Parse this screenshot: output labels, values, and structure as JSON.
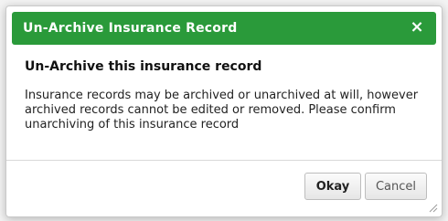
{
  "dialog": {
    "title": "Un-Archive Insurance Record",
    "close_symbol": "×",
    "heading": "Un-Archive this insurance record",
    "message": "Insurance records may be archived or unarchived at will, however archived records cannot be edited or removed. Please confirm unarchiving of this insurance record",
    "buttons": {
      "okay_label": "Okay",
      "cancel_label": "Cancel"
    },
    "colors": {
      "titlebar": "#2a9a3a",
      "title_text": "#ffffff"
    },
    "icons": {
      "close": "close-icon",
      "resize": "resize-grip-icon"
    }
  }
}
